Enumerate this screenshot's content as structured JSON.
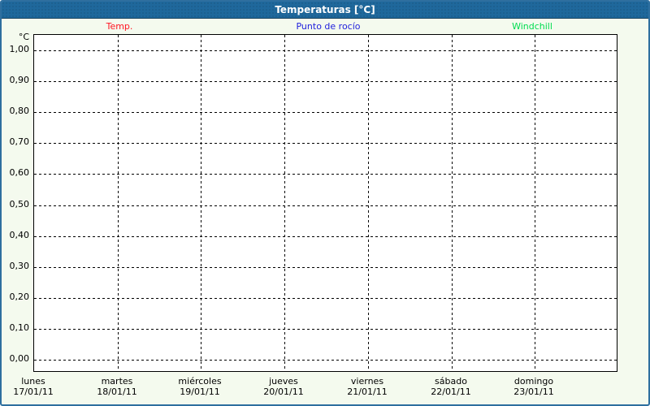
{
  "window": {
    "title": "Temperaturas [°C]"
  },
  "legend": {
    "items": [
      {
        "label": "Temp.",
        "color": "#ff1420"
      },
      {
        "label": "Punto de rocío",
        "color": "#1e1edc"
      },
      {
        "label": "Windchill",
        "color": "#00dc50"
      }
    ]
  },
  "chart_data": {
    "type": "line",
    "title": "Temperaturas [°C]",
    "ylabel": "°C",
    "ylim": [
      0.0,
      1.0
    ],
    "y_tick_step": 0.1,
    "y_tick_labels": [
      "1,00",
      "0,90",
      "0,80",
      "0,70",
      "0,60",
      "0,50",
      "0,40",
      "0,30",
      "0,20",
      "0,10",
      "0,00"
    ],
    "grid": "dashed",
    "legend_position": "top",
    "x_categories": [
      {
        "day": "lunes",
        "date": "17/01/11"
      },
      {
        "day": "martes",
        "date": "18/01/11"
      },
      {
        "day": "miércoles",
        "date": "19/01/11"
      },
      {
        "day": "jueves",
        "date": "20/01/11"
      },
      {
        "day": "viernes",
        "date": "21/01/11"
      },
      {
        "day": "sábado",
        "date": "22/01/11"
      },
      {
        "day": "domingo",
        "date": "23/01/11"
      }
    ],
    "series": [
      {
        "name": "Temp.",
        "color": "#ff1420",
        "values": []
      },
      {
        "name": "Punto de rocío",
        "color": "#1e1edc",
        "values": []
      },
      {
        "name": "Windchill",
        "color": "#00dc50",
        "values": []
      }
    ]
  },
  "colors": {
    "titlebar_bg": "#1f689c",
    "frame_border": "#2e6f9f",
    "page_bg": "#f4faee",
    "plot_bg": "#ffffff",
    "grid": "#000000"
  }
}
